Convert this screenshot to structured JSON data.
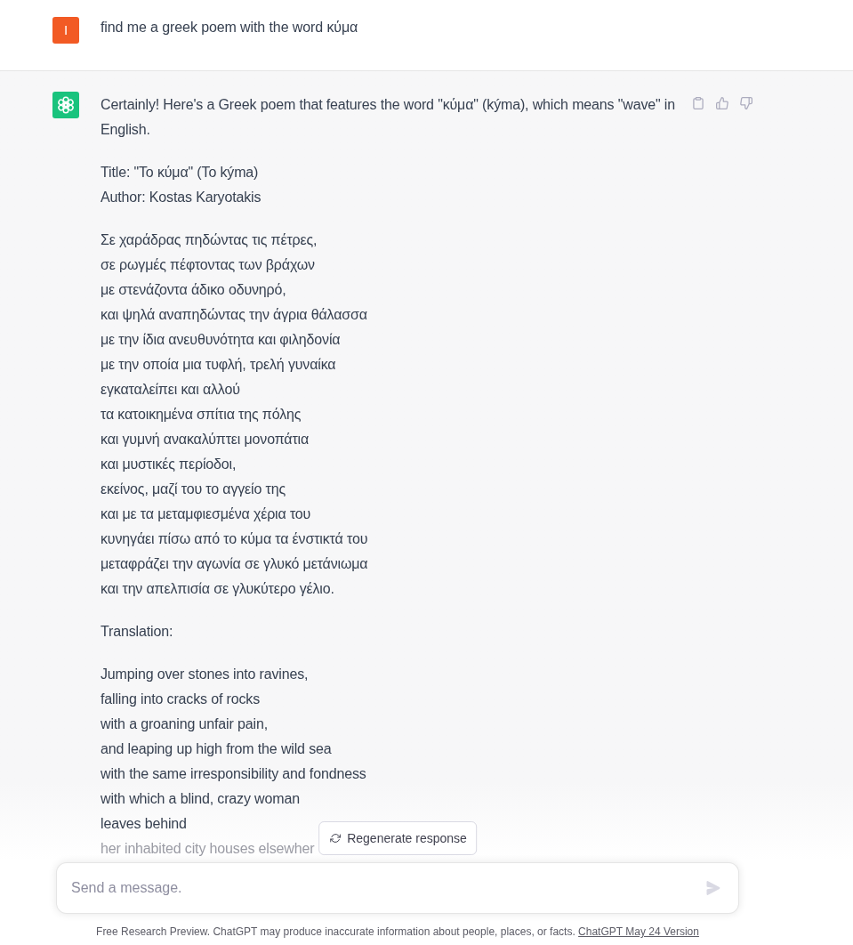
{
  "user_message": {
    "avatar_letter": "I",
    "text": "find me a greek poem with the word κύμα"
  },
  "assistant_message": {
    "intro": "Certainly! Here's a Greek poem that features the word \"κύμα\" (kýma), which means \"wave\" in English.",
    "poem_info": [
      "Title: \"Το κύμα\" (To kýma)",
      "Author: Kostas Karyotakis"
    ],
    "poem": [
      "Σε χαράδρας πηδώντας τις πέτρες,",
      "σε ρωγμές πέφτοντας των βράχων",
      "με στενάζοντα άδικο οδυνηρό,",
      "και ψηλά αναπηδώντας την άγρια θάλασσα",
      "με την ίδια ανευθυνότητα και φιληδονία",
      "με την οποία μια τυφλή, τρελή γυναίκα",
      "εγκαταλείπει και αλλού",
      "τα κατοικημένα σπίτια της πόλης",
      "και γυμνή ανακαλύπτει μονοπάτια",
      "και μυστικές περίοδοι,",
      "εκείνος, μαζί του το αγγείο της",
      "και με τα μεταμφιεσμένα χέρια του",
      "κυνηγάει πίσω από το κύμα τα ένστικτά του",
      "μεταφράζει την αγωνία σε γλυκό μετάνιωμα",
      "και την απελπισία σε γλυκύτερο γέλιο."
    ],
    "translation_heading": "Translation:",
    "translation": [
      "Jumping over stones into ravines,",
      "falling into cracks of rocks",
      "with a groaning unfair pain,",
      "and leaping up high from the wild sea",
      "with the same irresponsibility and fondness",
      "with which a blind, crazy woman",
      "leaves behind",
      "her inhabited city houses elsewher"
    ]
  },
  "regenerate_button": {
    "label": "Regenerate response"
  },
  "composer": {
    "placeholder": "Send a message.",
    "send_disabled": true
  },
  "footer": {
    "text": "Free Research Preview. ChatGPT may produce inaccurate information about people, places, or facts.",
    "link": "ChatGPT May 24 Version"
  }
}
